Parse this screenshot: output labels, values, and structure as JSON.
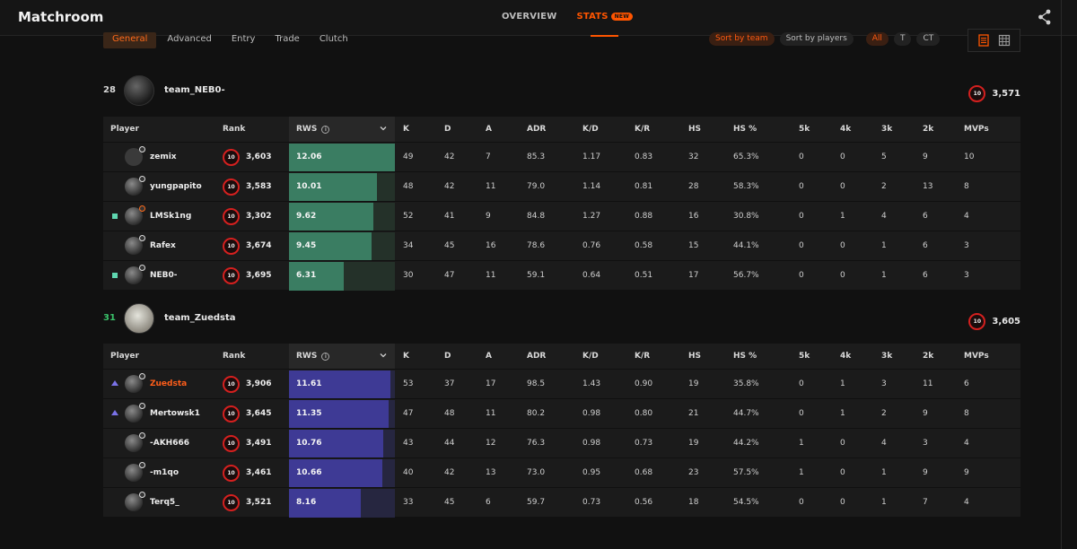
{
  "app": {
    "title": "Matchroom"
  },
  "nav": {
    "overview": "OVERVIEW",
    "stats": "STATS",
    "new_badge": "NEW"
  },
  "subtabs": [
    "General",
    "Advanced",
    "Entry",
    "Trade",
    "Clutch"
  ],
  "sort": {
    "by_team": "Sort by team",
    "by_players": "Sort by players",
    "side_all": "All",
    "side_t": "T",
    "side_ct": "CT"
  },
  "columns": [
    "Player",
    "Rank",
    "RWS",
    "K",
    "D",
    "A",
    "ADR",
    "K/D",
    "K/R",
    "HS",
    "HS %",
    "5k",
    "4k",
    "3k",
    "2k",
    "MVPs"
  ],
  "team1": {
    "score": "28",
    "name": "team_NEB0-",
    "elo": "3,571",
    "level": "10",
    "players": [
      {
        "name": "zemix",
        "party": "",
        "level": "10",
        "elo": "3,603",
        "rws": "12.06",
        "rws_frac": 1.0,
        "k": "49",
        "d": "42",
        "a": "7",
        "adr": "85.3",
        "kd": "1.17",
        "kr": "0.83",
        "hs": "32",
        "hsp": "65.3%",
        "k5": "0",
        "k4": "0",
        "k3": "5",
        "k2": "9",
        "mvps": "10"
      },
      {
        "name": "yungpapito",
        "party": "",
        "level": "10",
        "elo": "3,583",
        "rws": "10.01",
        "rws_frac": 0.83,
        "k": "48",
        "d": "42",
        "a": "11",
        "adr": "79.0",
        "kd": "1.14",
        "kr": "0.81",
        "hs": "28",
        "hsp": "58.3%",
        "k5": "0",
        "k4": "0",
        "k3": "2",
        "k2": "13",
        "mvps": "8"
      },
      {
        "name": "LMSk1ng",
        "party": "square",
        "level": "10",
        "elo": "3,302",
        "rws": "9.62",
        "rws_frac": 0.8,
        "k": "52",
        "d": "41",
        "a": "9",
        "adr": "84.8",
        "kd": "1.27",
        "kr": "0.88",
        "hs": "16",
        "hsp": "30.8%",
        "k5": "0",
        "k4": "1",
        "k3": "4",
        "k2": "6",
        "mvps": "4"
      },
      {
        "name": "Rafex",
        "party": "",
        "level": "10",
        "elo": "3,674",
        "rws": "9.45",
        "rws_frac": 0.78,
        "k": "34",
        "d": "45",
        "a": "16",
        "adr": "78.6",
        "kd": "0.76",
        "kr": "0.58",
        "hs": "15",
        "hsp": "44.1%",
        "k5": "0",
        "k4": "0",
        "k3": "1",
        "k2": "6",
        "mvps": "3"
      },
      {
        "name": "NEB0-",
        "party": "square",
        "level": "10",
        "elo": "3,695",
        "rws": "6.31",
        "rws_frac": 0.52,
        "k": "30",
        "d": "47",
        "a": "11",
        "adr": "59.1",
        "kd": "0.64",
        "kr": "0.51",
        "hs": "17",
        "hsp": "56.7%",
        "k5": "0",
        "k4": "0",
        "k3": "1",
        "k2": "6",
        "mvps": "3"
      }
    ]
  },
  "team2": {
    "score": "31",
    "name": "team_Zuedsta",
    "elo": "3,605",
    "level": "10",
    "players": [
      {
        "name": "Zuedsta",
        "party": "triangle",
        "level": "10",
        "elo": "3,906",
        "rws": "11.61",
        "rws_frac": 0.96,
        "k": "53",
        "d": "37",
        "a": "17",
        "adr": "98.5",
        "kd": "1.43",
        "kr": "0.90",
        "hs": "19",
        "hsp": "35.8%",
        "k5": "0",
        "k4": "1",
        "k3": "3",
        "k2": "11",
        "mvps": "6"
      },
      {
        "name": "Mertowsk1",
        "party": "triangle",
        "level": "10",
        "elo": "3,645",
        "rws": "11.35",
        "rws_frac": 0.94,
        "k": "47",
        "d": "48",
        "a": "11",
        "adr": "80.2",
        "kd": "0.98",
        "kr": "0.80",
        "hs": "21",
        "hsp": "44.7%",
        "k5": "0",
        "k4": "1",
        "k3": "2",
        "k2": "9",
        "mvps": "8"
      },
      {
        "name": "-AKH666",
        "party": "",
        "level": "10",
        "elo": "3,491",
        "rws": "10.76",
        "rws_frac": 0.89,
        "k": "43",
        "d": "44",
        "a": "12",
        "adr": "76.3",
        "kd": "0.98",
        "kr": "0.73",
        "hs": "19",
        "hsp": "44.2%",
        "k5": "1",
        "k4": "0",
        "k3": "4",
        "k2": "3",
        "mvps": "4"
      },
      {
        "name": "-m1qo",
        "party": "",
        "level": "10",
        "elo": "3,461",
        "rws": "10.66",
        "rws_frac": 0.88,
        "k": "40",
        "d": "42",
        "a": "13",
        "adr": "73.0",
        "kd": "0.95",
        "kr": "0.68",
        "hs": "23",
        "hsp": "57.5%",
        "k5": "1",
        "k4": "0",
        "k3": "1",
        "k2": "9",
        "mvps": "9"
      },
      {
        "name": "Terq5_",
        "party": "",
        "level": "10",
        "elo": "3,521",
        "rws": "8.16",
        "rws_frac": 0.68,
        "k": "33",
        "d": "45",
        "a": "6",
        "adr": "59.7",
        "kd": "0.73",
        "kr": "0.56",
        "hs": "18",
        "hsp": "54.5%",
        "k5": "0",
        "k4": "0",
        "k3": "1",
        "k2": "7",
        "mvps": "4"
      }
    ]
  }
}
